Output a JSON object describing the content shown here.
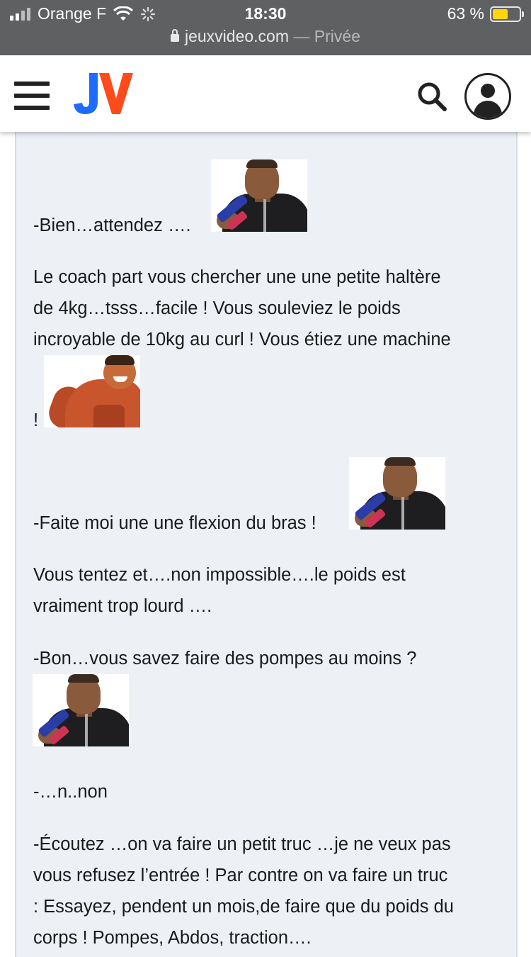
{
  "status": {
    "carrier": "Orange F",
    "time": "18:30",
    "battery": "63 %",
    "battery_level": 0.63,
    "url": "jeuxvideo.com",
    "url_suffix": "— Privée"
  },
  "appbar": {
    "logo": "JV"
  },
  "post": {
    "lines": [
      "-Bien…attendez ….",
      "Le coach part vous chercher une une petite haltère",
      "de 4kg…tsss…facile ! Vous souleviez le poids",
      "incroyable de 10kg au curl ! Vous étiez une machine",
      "!",
      "-Faite moi une une flexion du bras !",
      "Vous tentez et….non impossible….le poids est",
      "vraiment trop lourd ….",
      "-Bon…vous savez faire des pompes au moins ?",
      "-…n..non",
      "-Écoutez …on va faire un petit truc …je ne veux pas",
      "vous refusez l’entrée ! Par contre on va faire un truc",
      ": Essayez, pendent un mois,de faire que du poids du",
      "corps ! Pompes, Abdos, traction…."
    ]
  },
  "colors": {
    "statusbar": "#5f6062",
    "post_bg": "#edf0f5",
    "logo_blue": "#1e6bff",
    "logo_orange": "#ff4a1c"
  }
}
